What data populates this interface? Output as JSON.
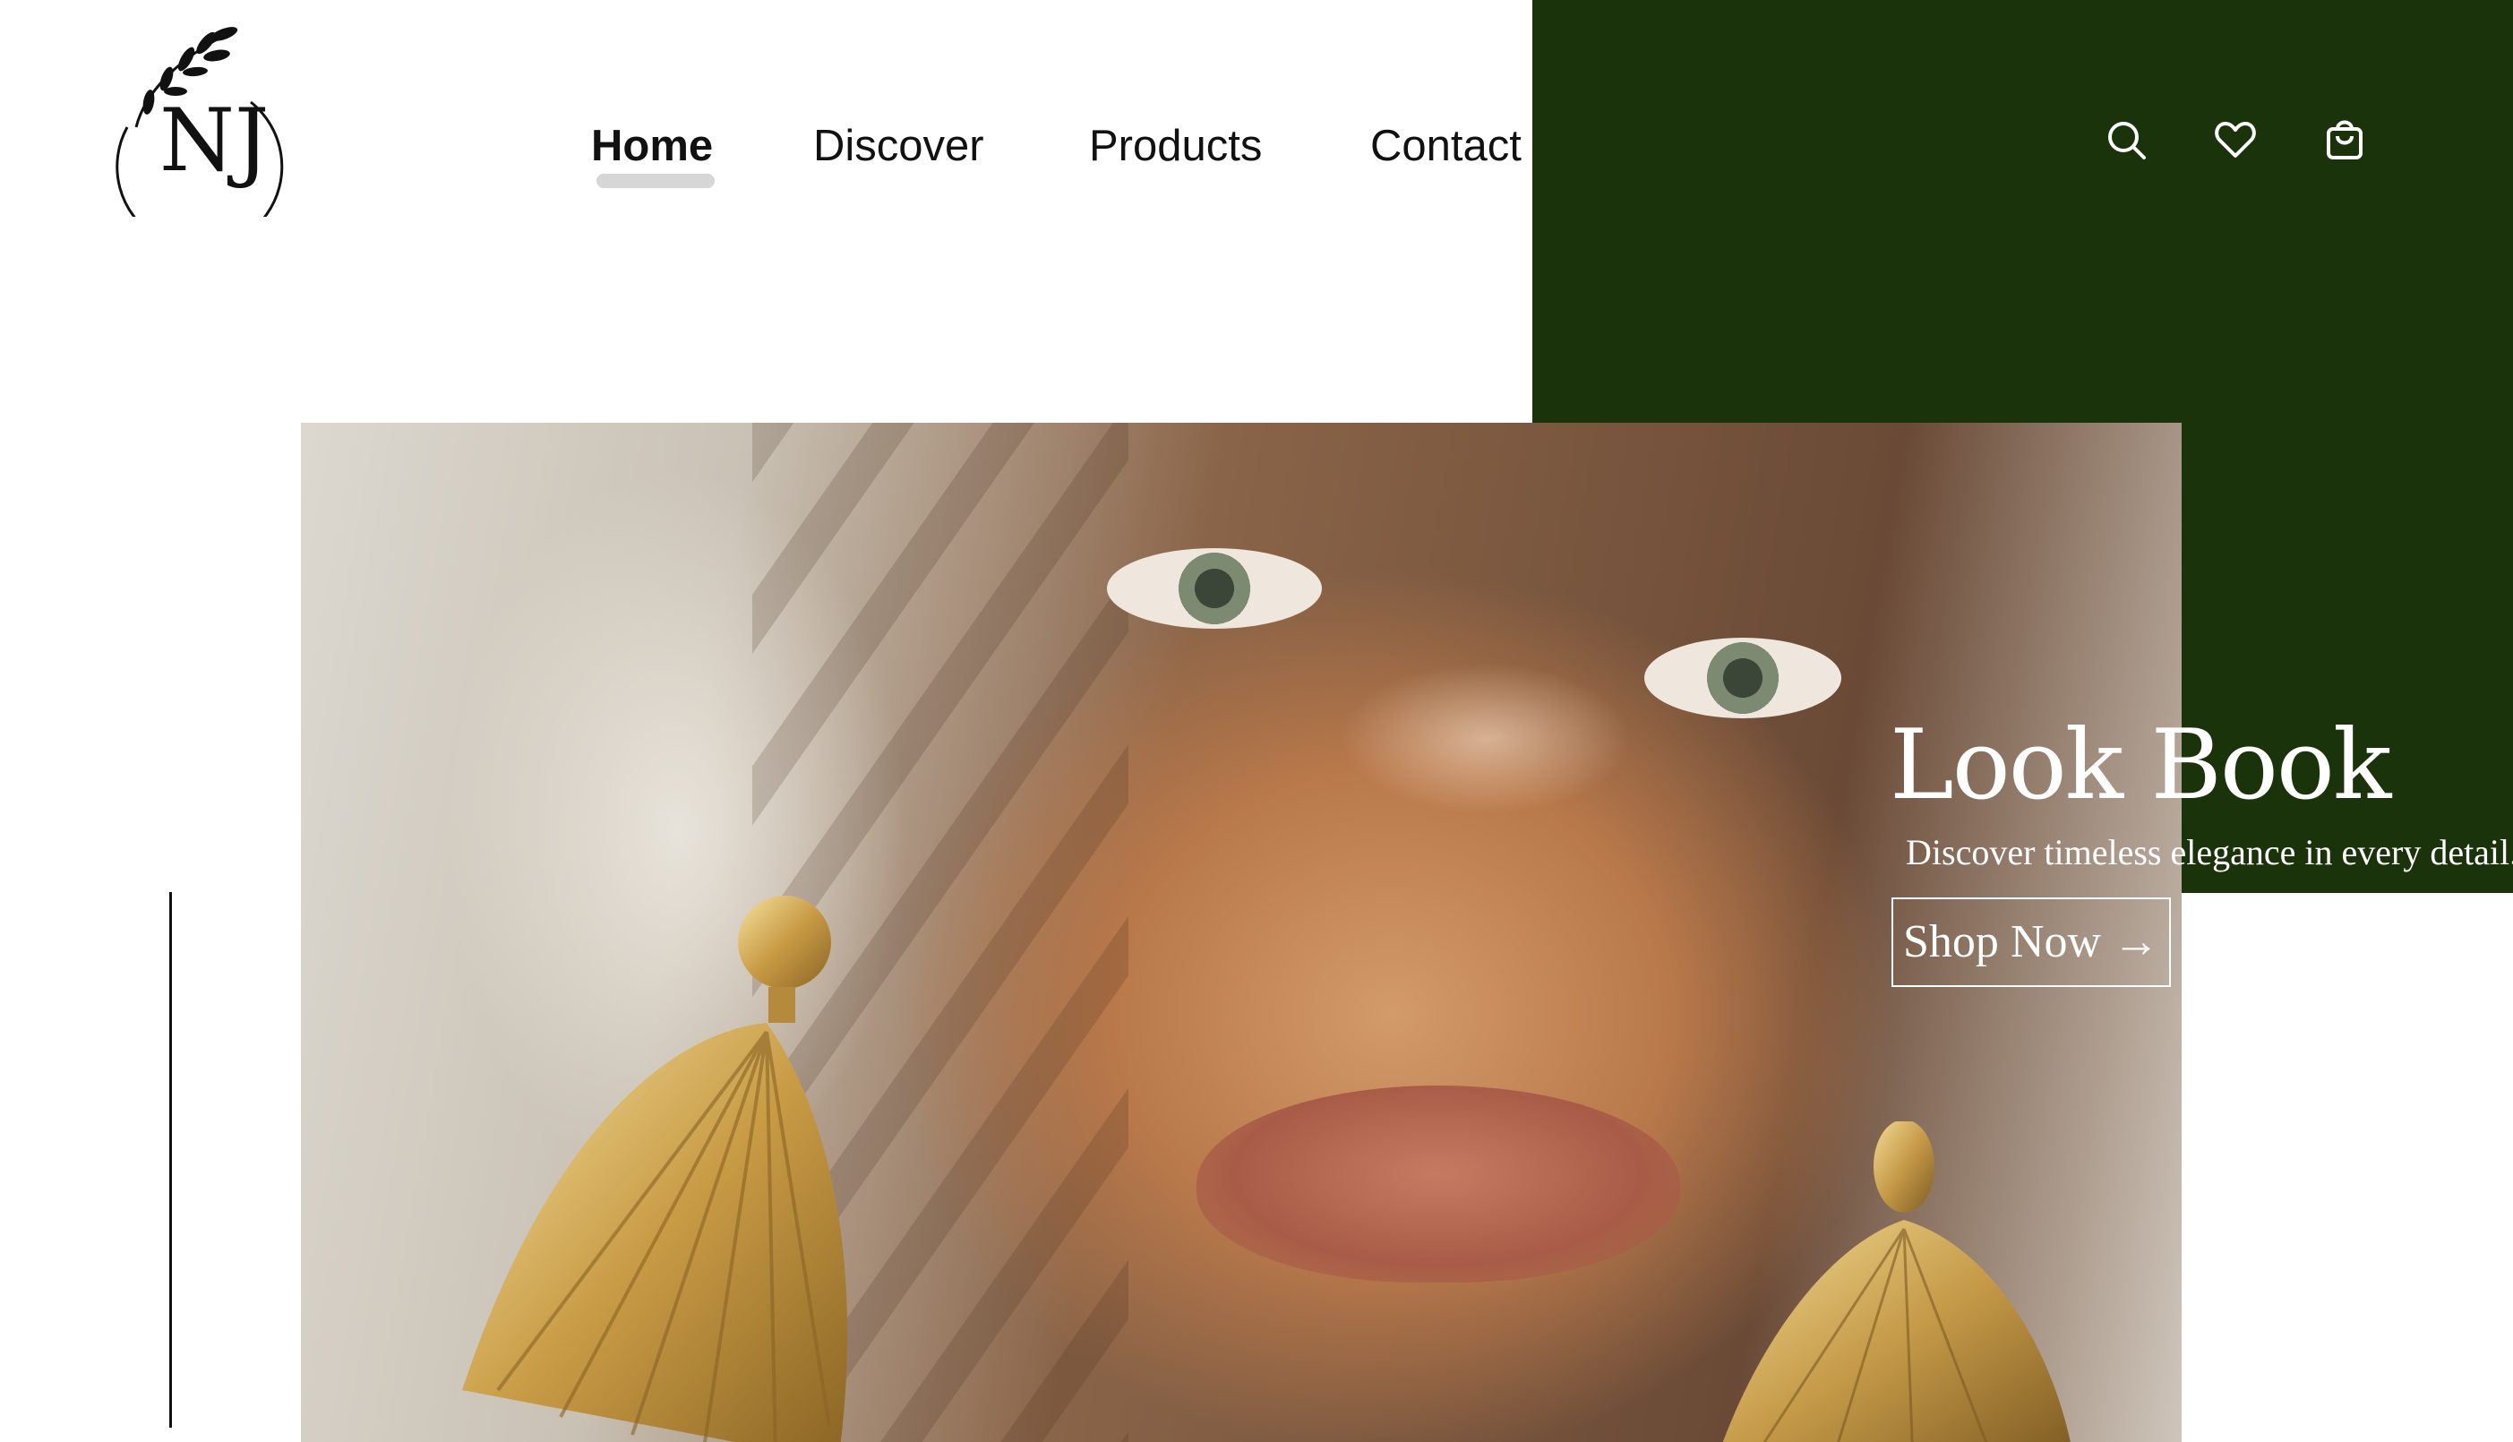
{
  "brand": {
    "logo_text": "NJ",
    "colors": {
      "accent_green": "#1b330b",
      "text_dark": "#111111",
      "white": "#ffffff"
    }
  },
  "nav": {
    "items": [
      {
        "label": "Home",
        "active": true
      },
      {
        "label": "Discover",
        "active": false
      },
      {
        "label": "Products",
        "active": false
      },
      {
        "label": "Contact",
        "active": false
      }
    ]
  },
  "header_icons": [
    {
      "name": "search-icon"
    },
    {
      "name": "heart-icon"
    },
    {
      "name": "shopping-bag-icon"
    }
  ],
  "hero": {
    "title": "Look Book",
    "subtitle": "Discover timeless elegance in every detail.",
    "cta_label": "Shop Now →"
  }
}
